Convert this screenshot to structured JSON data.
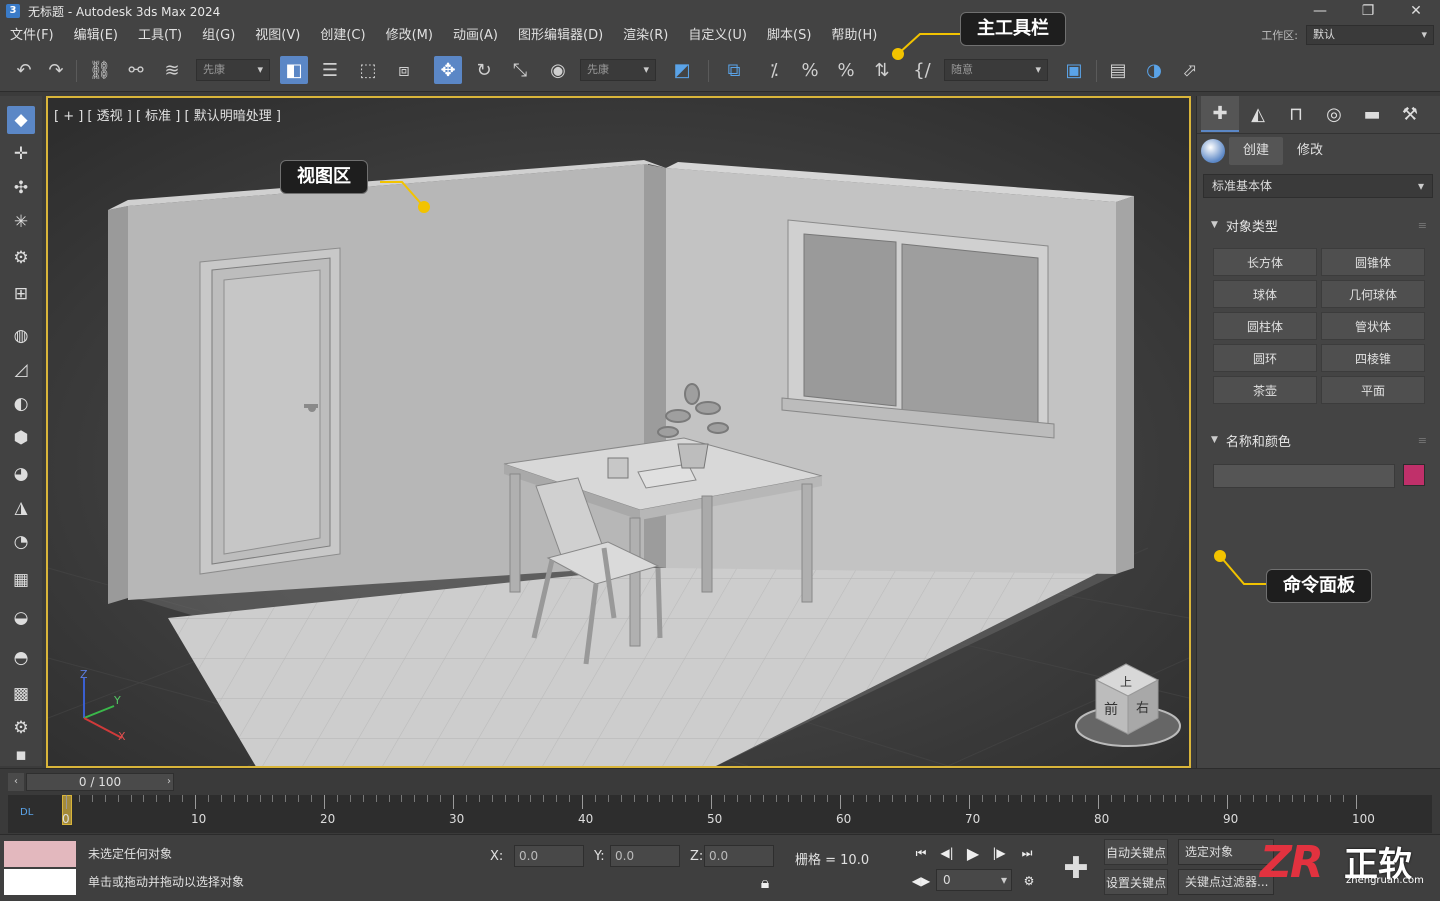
{
  "window": {
    "title": "无标题 - Autodesk 3ds Max 2024",
    "app_icon": "3",
    "controls": [
      "minimize-icon",
      "restore-icon",
      "close-icon"
    ]
  },
  "menu": {
    "items": [
      "文件(F)",
      "编辑(E)",
      "工具(T)",
      "组(G)",
      "视图(V)",
      "创建(C)",
      "修改(M)",
      "动画(A)",
      "图形编辑器(D)",
      "渲染(R)",
      "自定义(U)",
      "脚本(S)",
      "帮助(H)"
    ],
    "workspace_label": "工作区:",
    "workspace_value": "默认"
  },
  "toolbar": {
    "selection_filter": "先康",
    "ref_coord": "先康",
    "named_selection": "随意",
    "icons": [
      "undo-icon",
      "redo-icon",
      "link-icon",
      "unlink-icon",
      "bind-spacewarp-icon",
      "select-object-icon",
      "select-by-name-icon",
      "rect-selection-icon",
      "window-crossing-icon",
      "select-move-icon",
      "select-rotate-icon",
      "select-scale-icon",
      "select-place-icon",
      "use-pivot-icon",
      "keyboard-shortcut-icon",
      "snap-toggle-icon",
      "angle-snap-icon",
      "percent-snap-icon",
      "spinner-snap-icon",
      "edit-named-sel-icon",
      "mirror-icon",
      "align-icon",
      "scene-explorer-icon",
      "material-editor-icon",
      "render-setup-icon",
      "render-frame-icon"
    ]
  },
  "viewport": {
    "label": "[ + ] [ 透视 ] [ 标准 ] [ 默认明暗处理 ]",
    "viewcube_top": "上",
    "viewcube_front": "前",
    "viewcube_right": "右",
    "axis_x": "X",
    "axis_y": "Y",
    "axis_z": "Z"
  },
  "callouts": {
    "main_toolbar": "主工具栏",
    "viewport_area": "视图区",
    "command_panel": "命令面板"
  },
  "command_panel": {
    "tabs": [
      "create-tab-icon",
      "modify-tab-icon",
      "hierarchy-tab-icon",
      "motion-tab-icon",
      "display-tab-icon",
      "utilities-tab-icon"
    ],
    "subtab_create": "创建",
    "subtab_modify": "修改",
    "category": "标准基本体",
    "object_type_title": "对象类型",
    "object_types": [
      "长方体",
      "圆锥体",
      "球体",
      "几何球体",
      "圆柱体",
      "管状体",
      "圆环",
      "四棱锥",
      "茶壶",
      "平面"
    ],
    "name_color_title": "名称和颜色",
    "object_color": "#c0306a"
  },
  "timeline": {
    "frame_display": "0 / 100",
    "ticks": [
      "0",
      "10",
      "20",
      "30",
      "40",
      "50",
      "60",
      "70",
      "80",
      "90",
      "100"
    ],
    "dl_label": "DL"
  },
  "status": {
    "selection_info": "未选定任何对象",
    "prompt": "单击或拖动并拖动以选择对象",
    "x_label": "X:",
    "x_value": "0.0",
    "y_label": "Y:",
    "y_value": "0.0",
    "z_label": "Z:",
    "z_value": "0.0",
    "grid": "栅格 = 10.0",
    "frame_value": "0",
    "auto_key": "自动关键点",
    "set_key": "设置关键点",
    "selected_object": "选定对象",
    "key_filters": "关键点过滤器..."
  },
  "watermark": {
    "logo_mark": "ZR",
    "logo_text": "正软",
    "url": "zhengruan.com"
  }
}
